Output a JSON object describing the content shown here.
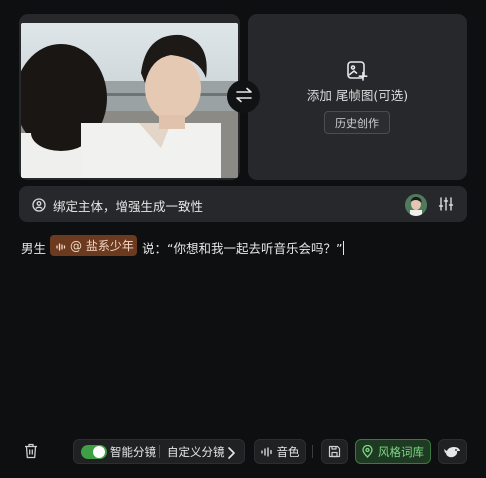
{
  "first_frame": {
    "image_alt": "photo-scene"
  },
  "last_frame": {
    "add_label": "添加 尾帧图(可选)",
    "history_button": "历史创作"
  },
  "bind_bar": {
    "text": "绑定主体，增强生成一致性"
  },
  "prompt": {
    "prefix": "男生",
    "voice_chip": "@ 盐系少年",
    "suffix": "说：“你想和我一起去听音乐会吗？”"
  },
  "toolbar": {
    "smart_storyboard": "智能分镜",
    "smart_storyboard_enabled": true,
    "custom_storyboard": "自定义分镜",
    "timbre": "音色",
    "style_library": "风格词库"
  },
  "colors": {
    "background": "#0e0f10",
    "panel": "#26282b",
    "accent_green": "#3e9f45",
    "voice_chip": "#6b3a1f"
  }
}
